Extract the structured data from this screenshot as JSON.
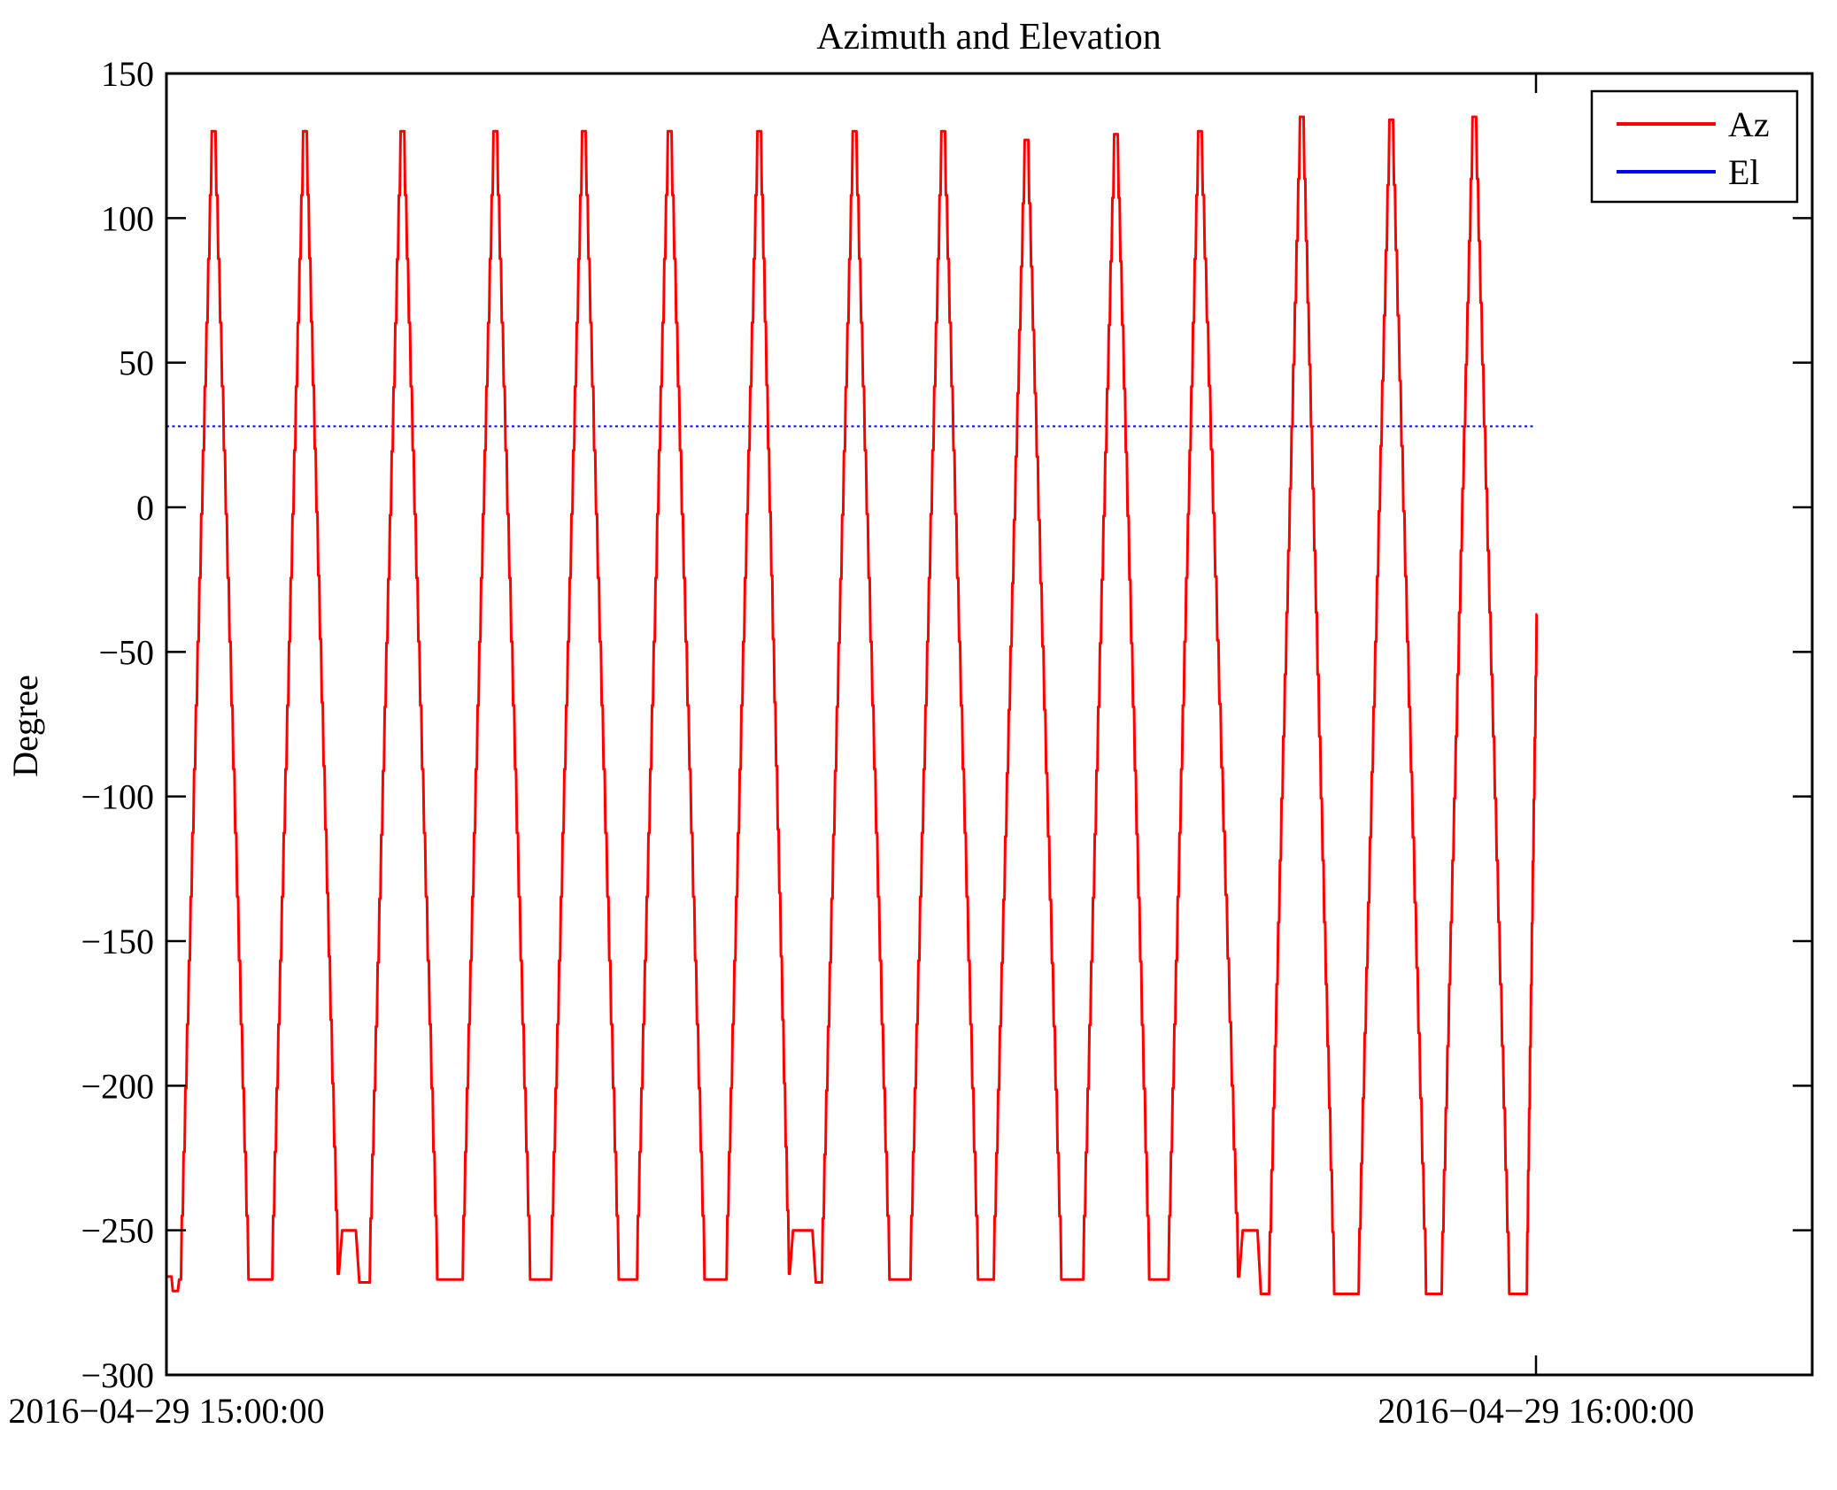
{
  "chart_data": {
    "type": "line",
    "title": "Azimuth and Elevation",
    "ylabel": "Degree",
    "xlabel": "",
    "ylim": [
      -300,
      150
    ],
    "xlim_minutes": [
      0,
      72.1
    ],
    "grid": false,
    "background": "#ffffff",
    "axis_color": "#000000",
    "y_ticks": [
      {
        "value": 150,
        "label": "150"
      },
      {
        "value": 100,
        "label": "100"
      },
      {
        "value": 50,
        "label": "50"
      },
      {
        "value": 0,
        "label": "0"
      },
      {
        "value": -50,
        "label": "−50"
      },
      {
        "value": -100,
        "label": "−100"
      },
      {
        "value": -150,
        "label": "−150"
      },
      {
        "value": -200,
        "label": "−200"
      },
      {
        "value": -250,
        "label": "−250"
      },
      {
        "value": -300,
        "label": "−300"
      }
    ],
    "x_ticks": [
      {
        "minutes": 0,
        "label": "2016−04−29 15:00:00"
      },
      {
        "minutes": 60,
        "label": "2016−04−29 16:00:00"
      }
    ],
    "legend": {
      "position": "upper right"
    },
    "series": [
      {
        "name": "Az",
        "color": "#ff0000",
        "style": "solid",
        "staircase_step_deg": 22,
        "points": [
          [
            0,
            -266
          ],
          [
            0.22,
            -266
          ],
          [
            0.28,
            -271
          ],
          [
            0.5,
            -271
          ],
          [
            0.56,
            -267
          ],
          [
            0.64,
            -267
          ],
          [
            2.03,
            130
          ],
          [
            2.15,
            130
          ],
          [
            3.64,
            -267
          ],
          [
            4.64,
            -267
          ],
          [
            6.03,
            130
          ],
          [
            6.15,
            130
          ],
          [
            7.55,
            -265
          ],
          [
            7.7,
            -250
          ],
          [
            8.3,
            -250
          ],
          [
            8.45,
            -268
          ],
          [
            8.91,
            -268
          ],
          [
            10.3,
            130
          ],
          [
            10.42,
            130
          ],
          [
            11.91,
            -267
          ],
          [
            12.98,
            -267
          ],
          [
            14.37,
            130
          ],
          [
            14.49,
            130
          ],
          [
            15.98,
            -267
          ],
          [
            16.86,
            -267
          ],
          [
            18.25,
            130
          ],
          [
            18.37,
            130
          ],
          [
            19.86,
            -267
          ],
          [
            20.62,
            -267
          ],
          [
            22.01,
            130
          ],
          [
            22.13,
            130
          ],
          [
            23.62,
            -267
          ],
          [
            24.54,
            -267
          ],
          [
            25.93,
            130
          ],
          [
            26.05,
            130
          ],
          [
            27.31,
            -265
          ],
          [
            27.45,
            -250
          ],
          [
            28.3,
            -250
          ],
          [
            28.45,
            -268
          ],
          [
            28.72,
            -268
          ],
          [
            30.11,
            130
          ],
          [
            30.23,
            130
          ],
          [
            31.72,
            -267
          ],
          [
            32.6,
            -267
          ],
          [
            33.99,
            130
          ],
          [
            34.11,
            130
          ],
          [
            35.6,
            -267
          ],
          [
            36.25,
            -267
          ],
          [
            37.64,
            127
          ],
          [
            37.76,
            127
          ],
          [
            39.25,
            -267
          ],
          [
            40.17,
            -267
          ],
          [
            41.56,
            129
          ],
          [
            41.68,
            129
          ],
          [
            43.1,
            -267
          ],
          [
            43.9,
            -267
          ],
          [
            45.24,
            130
          ],
          [
            45.36,
            130
          ],
          [
            47.0,
            -266
          ],
          [
            47.15,
            -250
          ],
          [
            47.8,
            -250
          ],
          [
            47.95,
            -272
          ],
          [
            48.31,
            -272
          ],
          [
            49.7,
            135
          ],
          [
            49.82,
            135
          ],
          [
            51.2,
            -272
          ],
          [
            52.23,
            -272
          ],
          [
            53.62,
            134
          ],
          [
            53.74,
            134
          ],
          [
            55.23,
            -272
          ],
          [
            55.87,
            -272
          ],
          [
            57.26,
            135
          ],
          [
            57.38,
            135
          ],
          [
            58.87,
            -272
          ],
          [
            59.6,
            -272
          ],
          [
            60.05,
            -37
          ]
        ]
      },
      {
        "name": "El",
        "color": "#0000ff",
        "style": "dotted",
        "value": 28,
        "points": [
          [
            0,
            28
          ],
          [
            60.0,
            28
          ]
        ]
      }
    ]
  }
}
